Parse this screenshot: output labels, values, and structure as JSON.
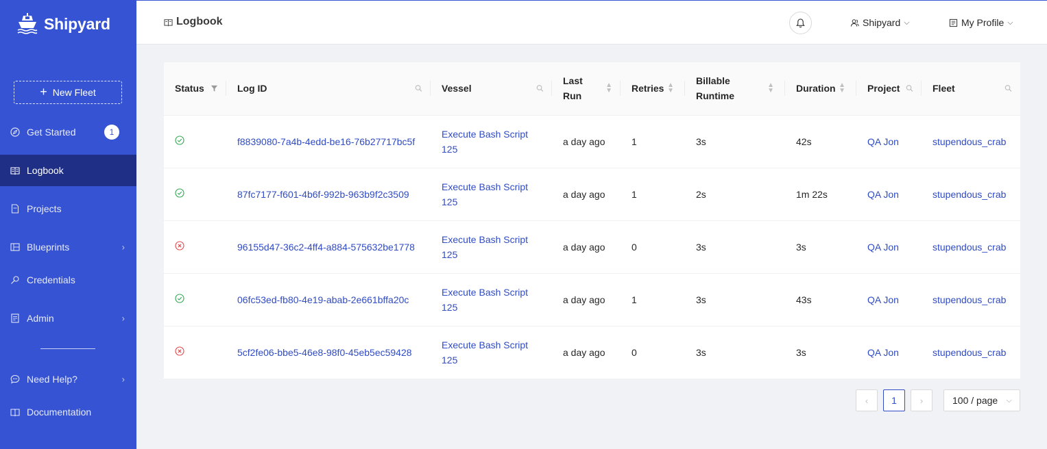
{
  "brand": {
    "name": "Shipyard"
  },
  "sidebar": {
    "new_fleet_label": "New Fleet",
    "items": [
      {
        "label": "Get Started",
        "icon": "compass-icon",
        "badge": "1"
      },
      {
        "label": "Logbook",
        "icon": "book-icon",
        "active": true
      },
      {
        "label": "Projects",
        "icon": "file-icon"
      },
      {
        "label": "Blueprints",
        "icon": "blueprint-icon",
        "has_submenu": true
      },
      {
        "label": "Credentials",
        "icon": "key-icon"
      },
      {
        "label": "Admin",
        "icon": "admin-icon",
        "has_submenu": true
      },
      {
        "label": "Need Help?",
        "icon": "chat-icon",
        "has_submenu": true
      },
      {
        "label": "Documentation",
        "icon": "doc-icon"
      }
    ]
  },
  "header": {
    "title": "Logbook",
    "org_menu": "Shipyard",
    "profile_menu": "My Profile"
  },
  "table": {
    "columns": [
      "Status",
      "Log ID",
      "Vessel",
      "Last Run",
      "Retries",
      "Billable Runtime",
      "Duration",
      "Project",
      "Fleet"
    ],
    "rows": [
      {
        "status": "success",
        "log_id": "f8839080-7a4b-4edd-be16-76b27717bc5f",
        "vessel": "Execute Bash Script 125",
        "last_run": "a day ago",
        "retries": "1",
        "billable_runtime": "3s",
        "duration": "42s",
        "project": "QA Jon",
        "fleet": "stupendous_crab"
      },
      {
        "status": "success",
        "log_id": "87fc7177-f601-4b6f-992b-963b9f2c3509",
        "vessel": "Execute Bash Script 125",
        "last_run": "a day ago",
        "retries": "1",
        "billable_runtime": "2s",
        "duration": "1m 22s",
        "project": "QA Jon",
        "fleet": "stupendous_crab"
      },
      {
        "status": "error",
        "log_id": "96155d47-36c2-4ff4-a884-575632be1778",
        "vessel": "Execute Bash Script 125",
        "last_run": "a day ago",
        "retries": "0",
        "billable_runtime": "3s",
        "duration": "3s",
        "project": "QA Jon",
        "fleet": "stupendous_crab"
      },
      {
        "status": "success",
        "log_id": "06fc53ed-fb80-4e19-abab-2e661bffa20c",
        "vessel": "Execute Bash Script 125",
        "last_run": "a day ago",
        "retries": "1",
        "billable_runtime": "3s",
        "duration": "43s",
        "project": "QA Jon",
        "fleet": "stupendous_crab"
      },
      {
        "status": "error",
        "log_id": "5cf2fe06-bbe5-46e8-98f0-45eb5ec59428",
        "vessel": "Execute Bash Script 125",
        "last_run": "a day ago",
        "retries": "0",
        "billable_runtime": "3s",
        "duration": "3s",
        "project": "QA Jon",
        "fleet": "stupendous_crab"
      }
    ]
  },
  "pagination": {
    "current_page": "1",
    "prev_icon": "chevron-left-icon",
    "next_icon": "chevron-right-icon",
    "page_size": "100 / page"
  },
  "colors": {
    "sidebar": "#3553d2",
    "sidebar_active": "#1f2f86",
    "link": "#2f4bc5",
    "success": "#2fa84f",
    "error": "#e5484d"
  }
}
